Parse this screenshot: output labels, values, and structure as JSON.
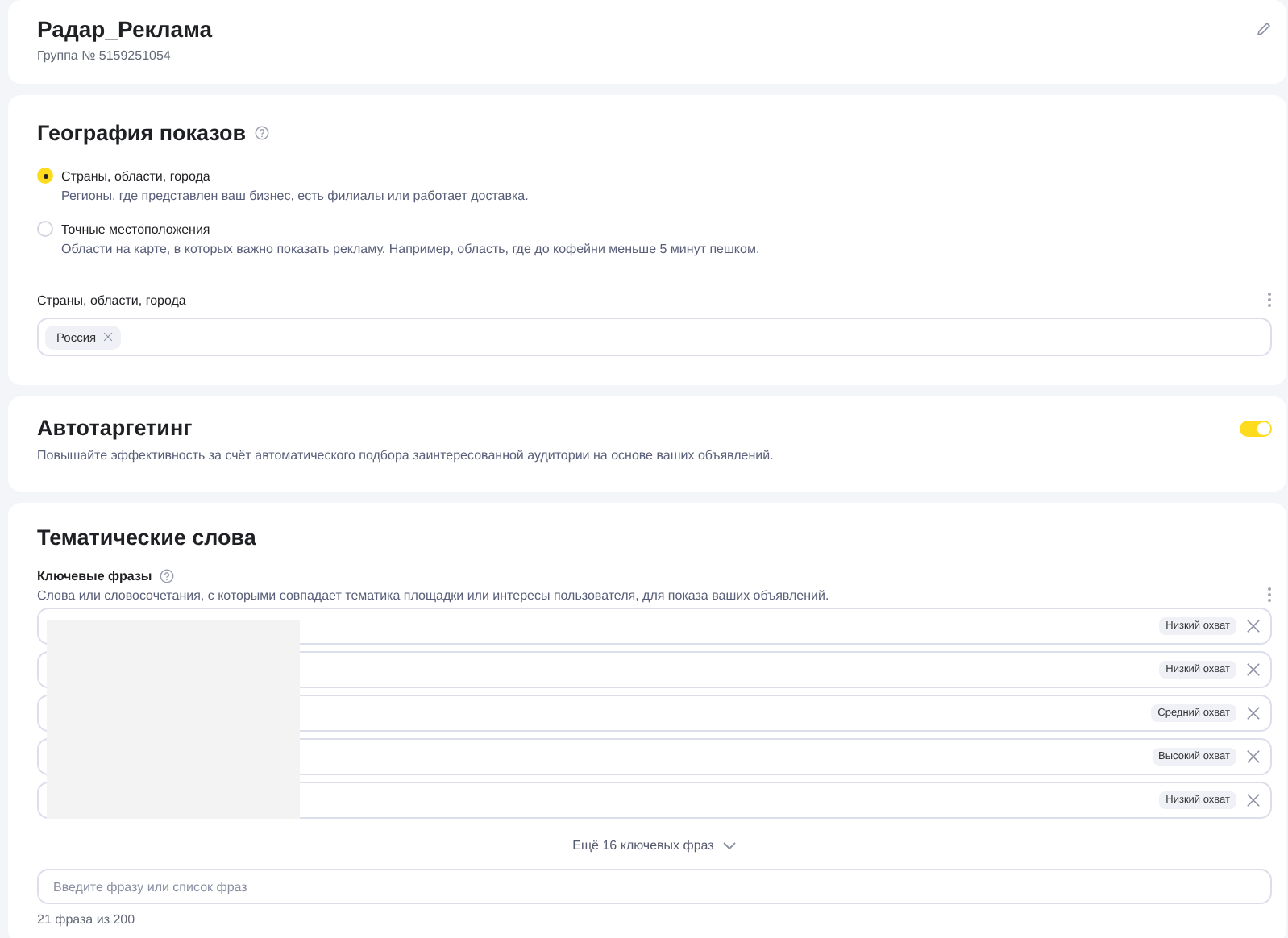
{
  "header": {
    "title": "Радар_Реклама",
    "subtitle": "Группа № 5159251054"
  },
  "geography": {
    "title": "География показов",
    "options": [
      {
        "label": "Страны, области, города",
        "description": "Регионы, где представлен ваш бизнес, есть филиалы или работает доставка.",
        "selected": true
      },
      {
        "label": "Точные местоположения",
        "description": "Области на карте, в которых важно показать рекламу. Например, область, где до кофейни меньше 5 минут пешком.",
        "selected": false
      }
    ],
    "field_label": "Страны, области, города",
    "tags": [
      "Россия"
    ]
  },
  "autotargeting": {
    "title": "Автотаргетинг",
    "description": "Повышайте эффективность за счёт автоматического подбора заинтересованной аудитории на основе ваших объявлений.",
    "on": true
  },
  "thematic": {
    "title": "Тематические слова",
    "field_label": "Ключевые фразы",
    "description": "Слова или словосочетания, с которыми совпадает тематика площадки или интересы пользователя, для показа ваших объявлений.",
    "phrases": [
      {
        "coverage": "Низкий охват"
      },
      {
        "coverage": "Низкий охват"
      },
      {
        "coverage": "Средний охват"
      },
      {
        "coverage": "Высокий охват"
      },
      {
        "coverage": "Низкий охват"
      }
    ],
    "more_link": "Ещё 16 ключевых фраз",
    "input": {
      "placeholder": "Введите фразу или список фраз"
    },
    "counter": "21 фраза из 200"
  }
}
